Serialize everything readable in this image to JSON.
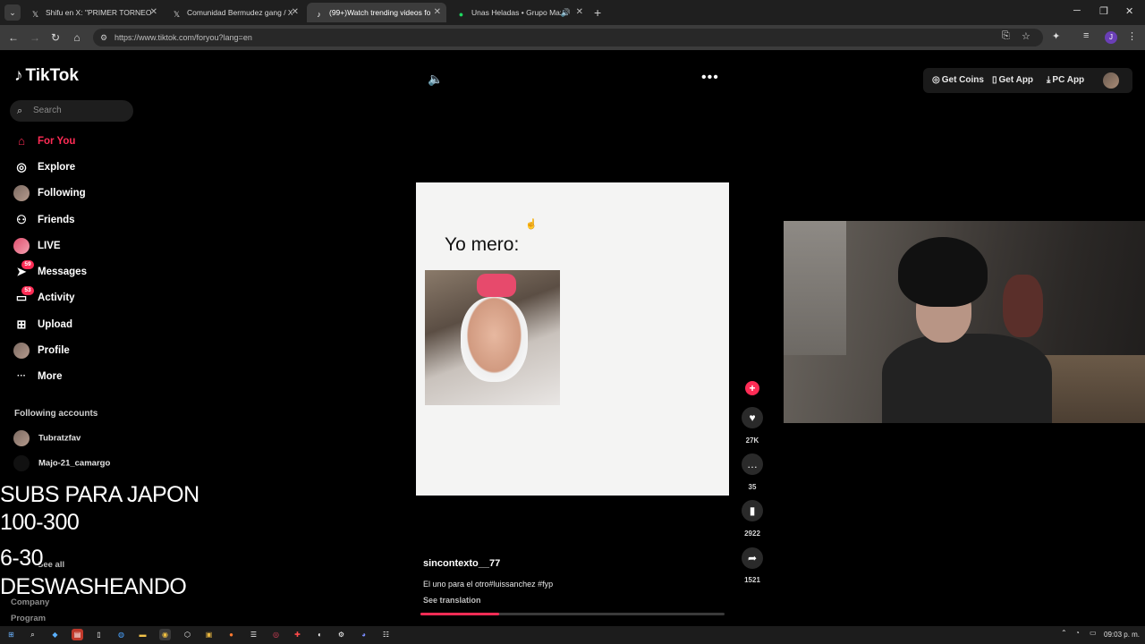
{
  "browser": {
    "tabs": [
      {
        "icon": "𝕏",
        "title": "Shifu en X: \"PRIMER TORNEO G",
        "active": false
      },
      {
        "icon": "𝕏",
        "title": "Comunidad Bermudez gang / X",
        "active": false
      },
      {
        "icon": "♪",
        "title": "(99+)Watch trending videos fo",
        "active": true
      },
      {
        "icon": "●",
        "title": "Unas Heladas • Grupo Max",
        "active": false,
        "audio": true
      }
    ],
    "url": "https://www.tiktok.com/foryou?lang=en",
    "profile_initial": "J"
  },
  "tiktok": {
    "logo": "TikTok",
    "search_placeholder": "Search",
    "nav": [
      {
        "label": "For You",
        "icon": "home-icon",
        "glyph": "⌂",
        "active": true
      },
      {
        "label": "Explore",
        "icon": "compass-icon",
        "glyph": "◎",
        "active": false
      },
      {
        "label": "Following",
        "icon": "following-avatar-icon",
        "glyph": "",
        "active": false
      },
      {
        "label": "Friends",
        "icon": "friends-icon",
        "glyph": "⚇",
        "active": false
      },
      {
        "label": "LIVE",
        "icon": "live-avatar-icon",
        "glyph": "",
        "active": false
      },
      {
        "label": "Messages",
        "icon": "messages-icon",
        "glyph": "➤",
        "badge": "59",
        "active": false
      },
      {
        "label": "Activity",
        "icon": "activity-icon",
        "glyph": "▭",
        "badge": "53",
        "active": false
      },
      {
        "label": "Upload",
        "icon": "upload-icon",
        "glyph": "⊞",
        "active": false
      },
      {
        "label": "Profile",
        "icon": "profile-avatar-icon",
        "glyph": "",
        "active": false
      },
      {
        "label": "More",
        "icon": "more-icon",
        "glyph": "···",
        "active": false
      }
    ],
    "following_title": "Following accounts",
    "following_accounts": [
      {
        "name": "Tubratzfav"
      },
      {
        "name": "Majo-21_camargo"
      }
    ],
    "see_all": "See all",
    "footer": [
      "Company",
      "Program"
    ],
    "top_actions": {
      "coins": "Get Coins",
      "app": "Get App",
      "pc_app": "PC App"
    },
    "video": {
      "caption": "Yo mero:",
      "author": "sincontexto__77",
      "description": "El uno para el otro#luissanchez #fyp",
      "see_translation": "See translation",
      "likes": "27K",
      "comments": "35",
      "saves": "2922",
      "shares": "1521",
      "progress_percent": 26
    }
  },
  "stream_overlay": {
    "lines": [
      "SUBS PARA JAPON",
      "100-300",
      "6-30",
      "DESWASHEANDO"
    ]
  },
  "taskbar": {
    "clock": "09:03 p. m."
  },
  "colors": {
    "accent": "#fe2c55",
    "background": "#000000"
  }
}
